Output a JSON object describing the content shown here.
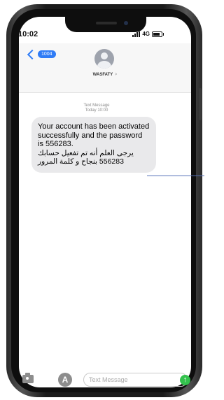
{
  "status_bar": {
    "time": "10:02",
    "network": "4G"
  },
  "header": {
    "back_badge": "1004",
    "contact_name": "WASFATY",
    "contact_caret": ">"
  },
  "thread": {
    "label": "Text Message",
    "timestamp": "Today 10:00"
  },
  "message": {
    "english": "Your account has been activated successfully and the password is 556283.",
    "arabic_line1": "يرجى العلم أنه تم تفعيل حسابك",
    "arabic_line2": "556283 بنجاح و كلمة المرور"
  },
  "composer": {
    "placeholder": "Text Message"
  },
  "icons": {
    "back": "chevron-left-icon",
    "avatar": "person-icon",
    "camera": "camera-icon",
    "apps": "app-store-icon",
    "send": "arrow-up-icon"
  },
  "colors": {
    "accent_blue": "#2f7cf6",
    "bubble_gray": "#e9e9eb",
    "send_green": "#33c24d",
    "frame_dark": "#1a1a1a"
  }
}
